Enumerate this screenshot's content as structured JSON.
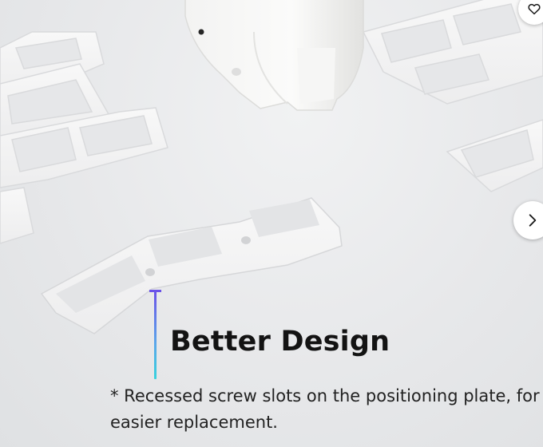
{
  "feature": {
    "title": "Better Design",
    "description": "* Recessed screw slots on the positioning plate, for easier replacement."
  },
  "controls": {
    "favorite_icon": "heart-icon",
    "next_icon": "chevron-right-icon"
  },
  "colors": {
    "accent_top": "#6b53e8",
    "accent_bottom": "#37d2dd",
    "title": "#131313",
    "background": "#e9eaec"
  }
}
